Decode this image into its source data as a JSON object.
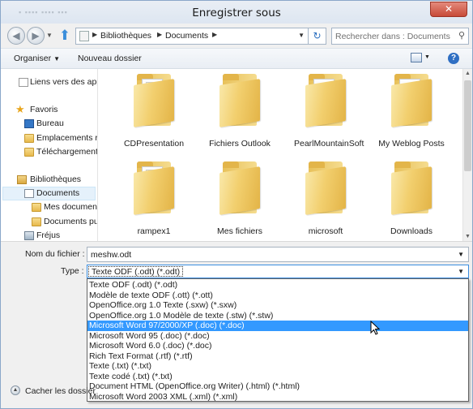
{
  "window": {
    "title": "Enregistrer sous",
    "close_label": "✕"
  },
  "address": {
    "crumbs": [
      "Bibliothèques",
      "Documents"
    ],
    "search_placeholder": "Rechercher dans : Documents"
  },
  "toolbar": {
    "organize_label": "Organiser",
    "new_folder_label": "Nouveau dossier",
    "help_label": "?"
  },
  "nav": {
    "items": [
      {
        "label": "Liens vers des appl",
        "icon": "link-icon"
      },
      {
        "label": "Favoris",
        "icon": "star-icon"
      },
      {
        "label": "Bureau",
        "icon": "desktop-icon"
      },
      {
        "label": "Emplacements ré",
        "icon": "recent-places-icon"
      },
      {
        "label": "Téléchargements",
        "icon": "downloads-icon"
      },
      {
        "label": "Bibliothèques",
        "icon": "libraries-icon"
      },
      {
        "label": "Documents",
        "icon": "documents-icon",
        "selected": true
      },
      {
        "label": "Mes document",
        "icon": "folder-icon"
      },
      {
        "label": "Documents pu",
        "icon": "folder-icon"
      },
      {
        "label": "Fréjus",
        "icon": "computer-icon"
      }
    ]
  },
  "files": [
    {
      "label": "CDPresentation",
      "papers": true
    },
    {
      "label": "Fichiers Outlook",
      "papers": false
    },
    {
      "label": "PearlMountainSoft",
      "papers": true
    },
    {
      "label": "My Weblog Posts",
      "papers": true
    },
    {
      "label": "rampex1",
      "papers": true
    },
    {
      "label": "Mes fichiers",
      "papers": false
    },
    {
      "label": "microsoft",
      "papers": false
    },
    {
      "label": "Downloads",
      "papers": false
    }
  ],
  "form": {
    "filename_label": "Nom du fichier :",
    "filename_value": "meshw.odt",
    "type_label": "Type :",
    "type_value": "Texte ODF (.odt) (*.odt)"
  },
  "type_options": [
    "Texte ODF (.odt) (*.odt)",
    "Modèle de texte ODF (.ott) (*.ott)",
    "OpenOffice.org 1.0 Texte (.sxw) (*.sxw)",
    "OpenOffice.org 1.0 Modèle de texte (.stw) (*.stw)",
    "Microsoft Word 97/2000/XP (.doc) (*.doc)",
    "Microsoft Word 95 (.doc) (*.doc)",
    "Microsoft Word 6.0 (.doc) (*.doc)",
    "Rich Text Format (.rtf) (*.rtf)",
    "Texte (.txt) (*.txt)",
    "Texte codé (.txt) (*.txt)",
    "Document HTML (OpenOffice.org Writer) (.html) (*.html)",
    "Microsoft Word 2003 XML (.xml) (*.xml)"
  ],
  "highlighted_option": 4,
  "bottom": {
    "hide_folders_label": "Cacher les dossier"
  }
}
